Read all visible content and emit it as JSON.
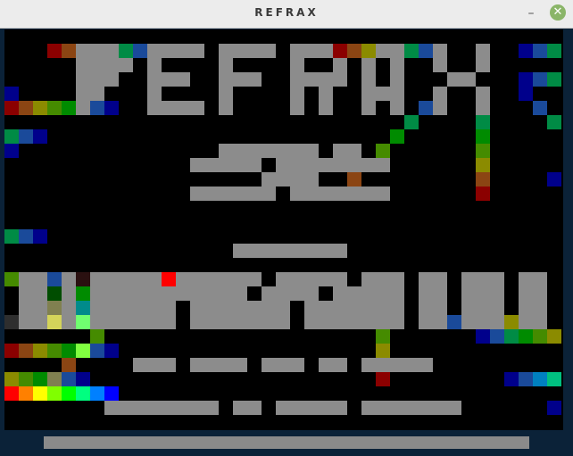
{
  "window": {
    "title": "REFRAX",
    "minimize_glyph": "–",
    "close_glyph": "✕"
  },
  "colors": {
    "background": "#000000",
    "wall_gray": "#8c8c8c",
    "frame": "#0b2238",
    "title_bar": "#ececec",
    "close_button": "#8ab568",
    "palette": [
      "#ff0000",
      "#ff8000",
      "#ffff00",
      "#80ff00",
      "#00ff00",
      "#00ff80",
      "#0080ff",
      "#0000ff"
    ]
  }
}
